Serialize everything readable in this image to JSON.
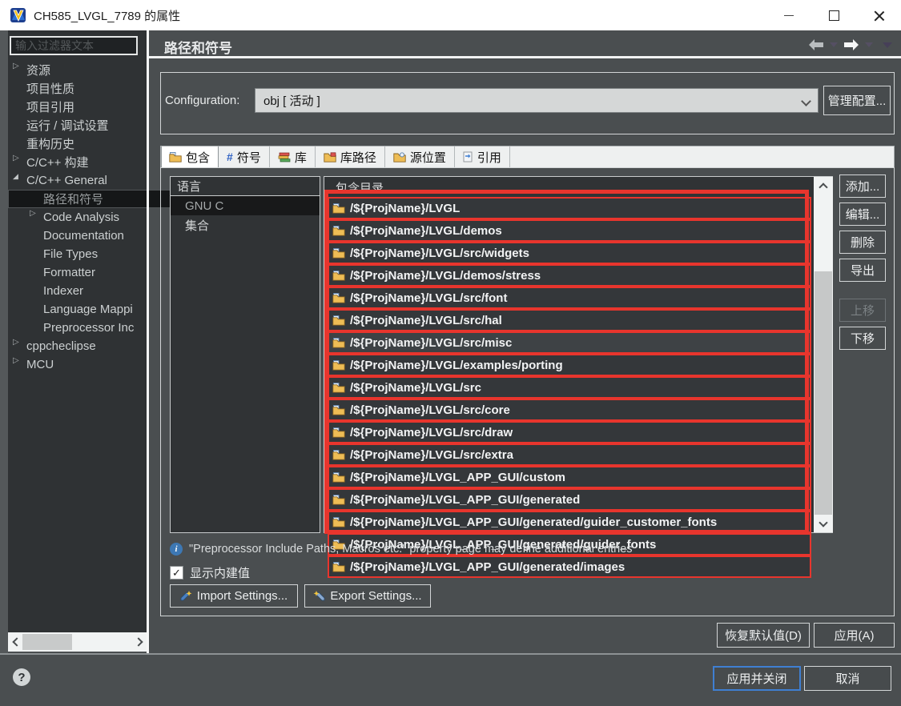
{
  "window": {
    "title": "CH585_LVGL_7789 的属性"
  },
  "header": {
    "title": "路径和符号"
  },
  "sidebar": {
    "filter_placeholder": "输入过滤器文本",
    "items": [
      {
        "label": "资源",
        "arrow": "collapsed",
        "level": 0
      },
      {
        "label": "项目性质",
        "level": 0
      },
      {
        "label": "项目引用",
        "level": 0
      },
      {
        "label": "运行 / 调试设置",
        "level": 0
      },
      {
        "label": "重构历史",
        "level": 0
      },
      {
        "label": "C/C++ 构建",
        "arrow": "collapsed",
        "level": 0
      },
      {
        "label": "C/C++ General",
        "arrow": "expanded",
        "level": 0
      },
      {
        "label": "路径和符号",
        "level": 1,
        "selected": true
      },
      {
        "label": "Code Analysis",
        "arrow": "collapsed",
        "level": 1
      },
      {
        "label": "Documentation",
        "level": 1
      },
      {
        "label": "File Types",
        "level": 1
      },
      {
        "label": "Formatter",
        "level": 1
      },
      {
        "label": "Indexer",
        "level": 1
      },
      {
        "label": "Language Mappi",
        "level": 1
      },
      {
        "label": "Preprocessor Inc",
        "level": 1
      },
      {
        "label": "cppcheclipse",
        "arrow": "collapsed",
        "level": 0
      },
      {
        "label": "MCU",
        "arrow": "collapsed",
        "level": 0
      }
    ]
  },
  "configuration": {
    "label": "Configuration:",
    "value": "obj [ 活动 ]",
    "manage": "管理配置..."
  },
  "tabs": [
    {
      "label": "包含",
      "icon": "include-folder-icon",
      "active": true
    },
    {
      "label": "符号",
      "icon": "hash-icon"
    },
    {
      "label": "库",
      "icon": "library-icon"
    },
    {
      "label": "库路径",
      "icon": "library-path-folder-icon"
    },
    {
      "label": "源位置",
      "icon": "source-location-folder-icon"
    },
    {
      "label": "引用",
      "icon": "reference-icon"
    }
  ],
  "languages": {
    "header": "语言",
    "items": [
      {
        "label": "GNU C",
        "selected": true
      },
      {
        "label": "集合"
      }
    ]
  },
  "includes": {
    "header": "包含目录",
    "rows": [
      {
        "path": "/${ProjName}/LVGL"
      },
      {
        "path": "/${ProjName}/LVGL/demos"
      },
      {
        "path": "/${ProjName}/LVGL/src/widgets"
      },
      {
        "path": "/${ProjName}/LVGL/demos/stress"
      },
      {
        "path": "/${ProjName}/LVGL/src/font"
      },
      {
        "path": "/${ProjName}/LVGL/src/hal"
      },
      {
        "path": "/${ProjName}/LVGL/src/misc",
        "highlight": true
      },
      {
        "path": "/${ProjName}/LVGL/examples/porting"
      },
      {
        "path": "/${ProjName}/LVGL/src"
      },
      {
        "path": "/${ProjName}/LVGL/src/core"
      },
      {
        "path": "/${ProjName}/LVGL/src/draw"
      },
      {
        "path": "/${ProjName}/LVGL/src/extra"
      },
      {
        "path": "/${ProjName}/LVGL_APP_GUI/custom"
      },
      {
        "path": "/${ProjName}/LVGL_APP_GUI/generated"
      },
      {
        "path": "/${ProjName}/LVGL_APP_GUI/generated/guider_customer_fonts"
      },
      {
        "path": "/${ProjName}/LVGL_APP_GUI/generated/guider_fonts"
      },
      {
        "path": "/${ProjName}/LVGL_APP_GUI/generated/images"
      }
    ]
  },
  "actions": {
    "add": "添加...",
    "edit": "编辑...",
    "remove": "删除",
    "export": "导出",
    "move_up": "上移",
    "move_down": "下移"
  },
  "notes": {
    "info": "\"Preprocessor Include Paths, Macros etc.\" property page may define additional entries",
    "show_builtin_label": "显示内建值",
    "show_builtin_checked": true
  },
  "settings_buttons": {
    "import": "Import Settings...",
    "export": "Export Settings..."
  },
  "footer": {
    "restore": "恢复默认值(D)",
    "apply": "应用(A)",
    "apply_close": "应用并关闭",
    "cancel": "取消"
  },
  "icons": {
    "logo": "mounriver-logo",
    "back": "back-arrow-icon",
    "forward": "forward-arrow-icon",
    "view_menu": "view-menu-chevron-icon",
    "row_icon": "include-folder-icon",
    "help": "help-icon",
    "info": "info-icon"
  },
  "colors": {
    "annotation_red": "#e8352d",
    "default_button_blue": "#3f7fd2",
    "dialog_background": "#4a4e50",
    "panel_background": "#303335"
  }
}
